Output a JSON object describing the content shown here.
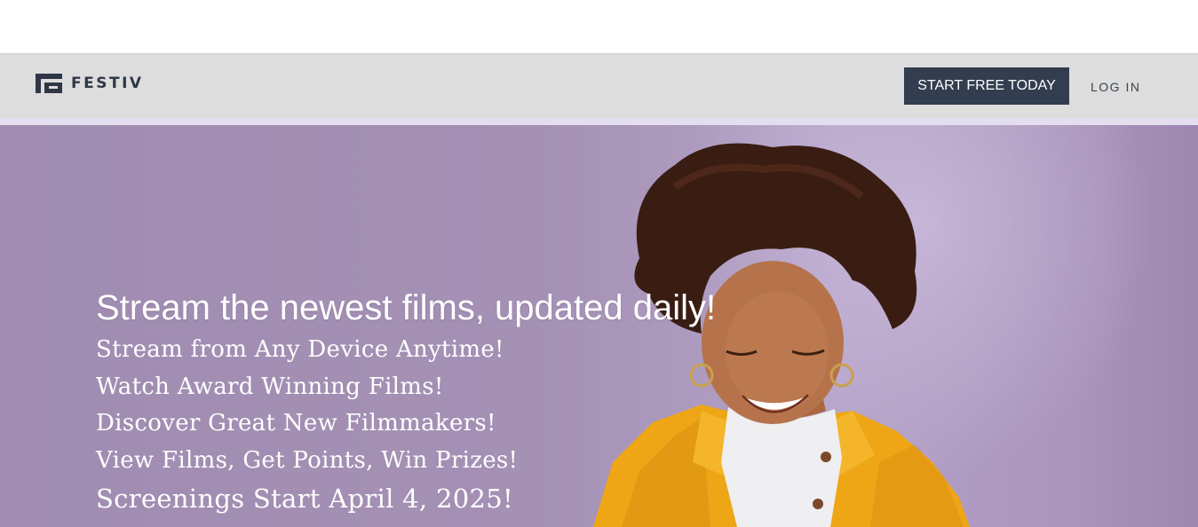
{
  "brand": {
    "name": "FESTIV",
    "logo_icon": "festiv-logo-mark"
  },
  "nav": {
    "start_button": "START FREE TODAY",
    "login_link": "LOG IN"
  },
  "hero": {
    "headline": "Stream the newest films, updated daily!",
    "features": [
      "Stream from Any Device Anytime!",
      "Watch Award Winning Films!",
      "Discover Great New Filmmakers!",
      "View Films, Get Points, Win Prizes!",
      "Screenings Start April 4, 2025!"
    ],
    "image": "woman-smiling-yellow-jacket-photo"
  },
  "colors": {
    "nav_bg": "#dddddd",
    "button_bg": "#323d4f",
    "hero_bg": "#a491b4",
    "text_light": "#ffffff"
  }
}
